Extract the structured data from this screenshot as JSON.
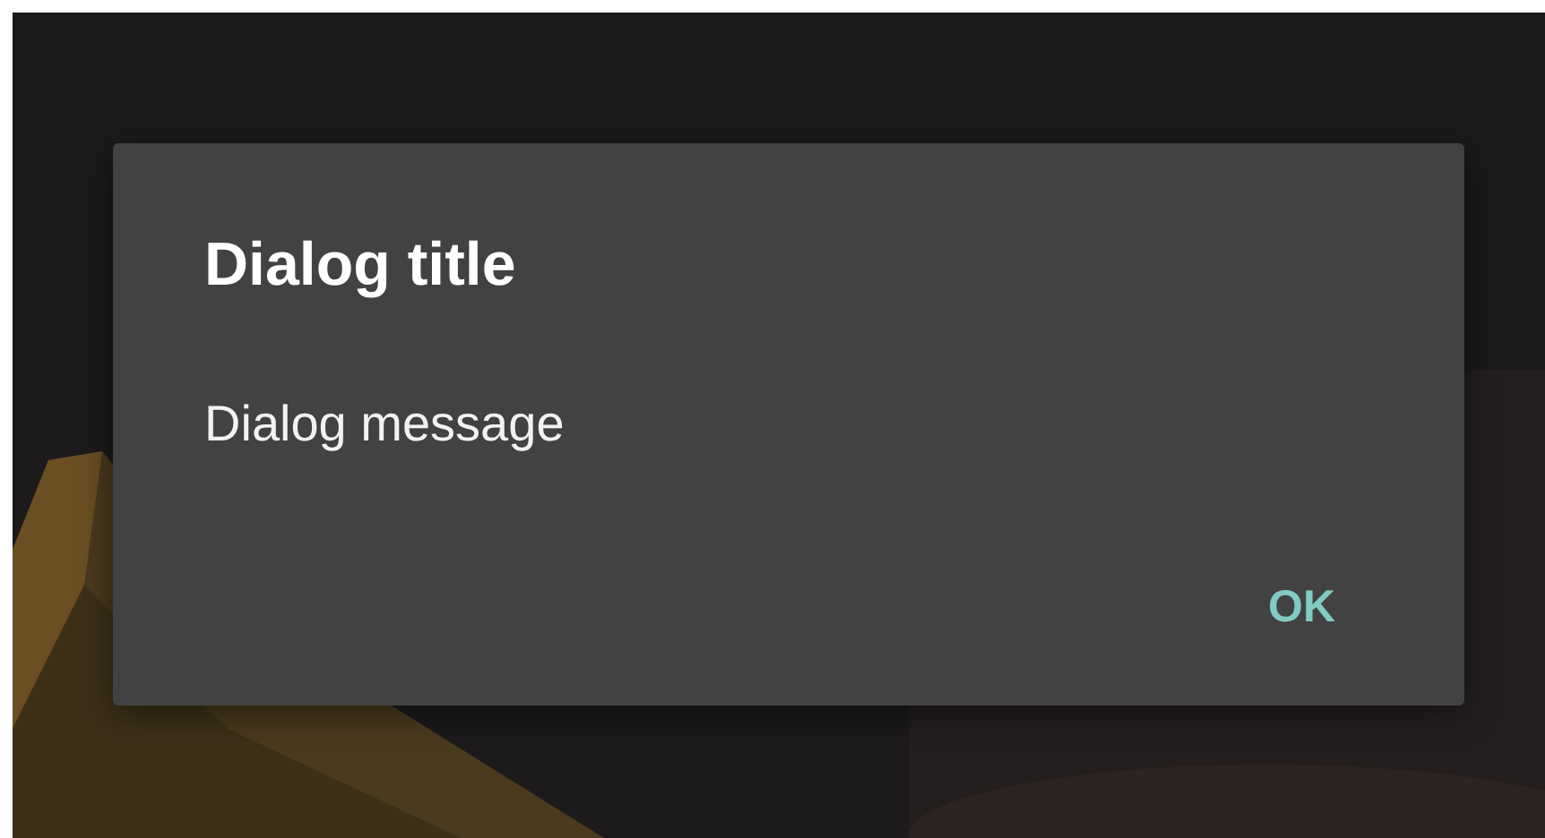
{
  "dialog": {
    "title": "Dialog title",
    "message": "Dialog message",
    "buttons": [
      "OK"
    ]
  }
}
